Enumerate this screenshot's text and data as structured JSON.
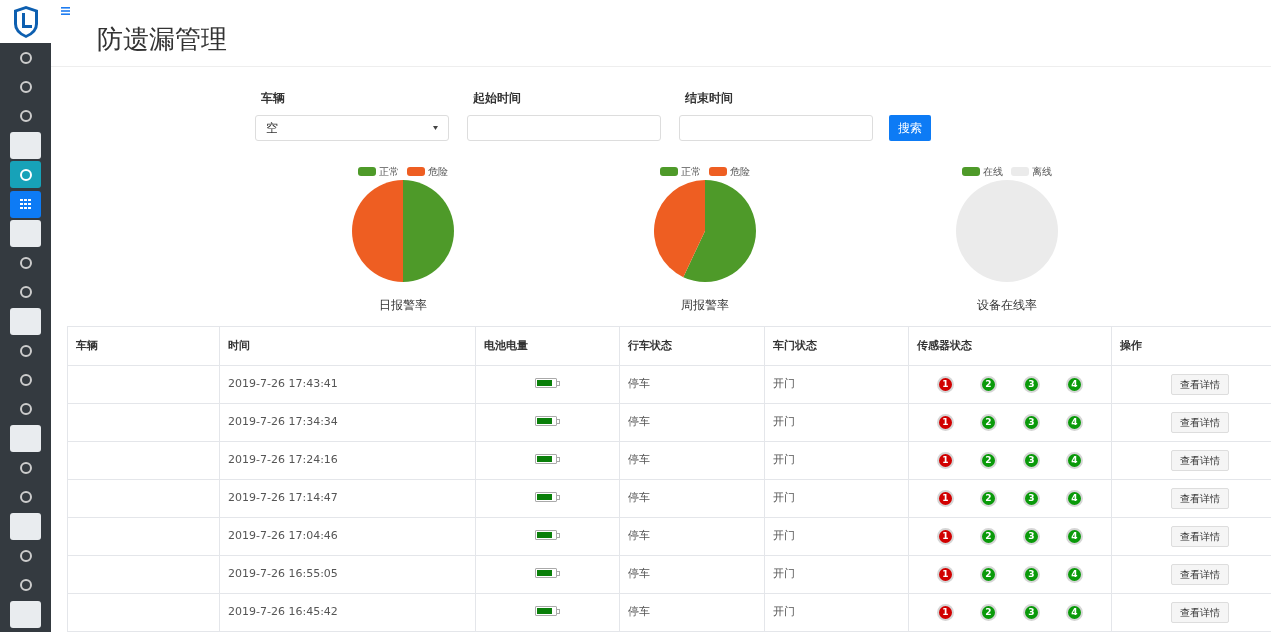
{
  "sidebar": {
    "items": [
      {
        "kind": "circle",
        "selected": false
      },
      {
        "kind": "circle",
        "selected": false
      },
      {
        "kind": "circle",
        "selected": false
      },
      {
        "kind": "blank",
        "selected": false
      },
      {
        "kind": "circle",
        "selected": false,
        "highlighted": true
      },
      {
        "kind": "grid",
        "selected": true
      },
      {
        "kind": "blank",
        "selected": false
      },
      {
        "kind": "circle",
        "selected": false
      },
      {
        "kind": "circle",
        "selected": false
      },
      {
        "kind": "blank",
        "selected": false
      },
      {
        "kind": "circle",
        "selected": false
      },
      {
        "kind": "circle",
        "selected": false
      },
      {
        "kind": "circle",
        "selected": false
      },
      {
        "kind": "blank",
        "selected": false
      },
      {
        "kind": "circle",
        "selected": false
      },
      {
        "kind": "circle",
        "selected": false
      },
      {
        "kind": "blank",
        "selected": false
      },
      {
        "kind": "circle",
        "selected": false
      },
      {
        "kind": "circle",
        "selected": false
      },
      {
        "kind": "blank",
        "selected": false
      }
    ]
  },
  "page_title": "防遗漏管理",
  "filters": [
    {
      "kind": "select",
      "label": "车辆",
      "value": "空"
    },
    {
      "kind": "input",
      "label": "起始时间"
    },
    {
      "kind": "input",
      "label": "结束时间"
    }
  ],
  "search_button": "搜索",
  "charts": [
    {
      "title": "日报警率",
      "legend": [
        {
          "label": "正常",
          "color": "#4e9a29"
        },
        {
          "label": "危险",
          "color": "#ee5e22"
        }
      ]
    },
    {
      "title": "周报警率",
      "legend": [
        {
          "label": "正常",
          "color": "#4e9a29"
        },
        {
          "label": "危险",
          "color": "#ee5e22"
        }
      ]
    },
    {
      "title": "设备在线率",
      "legend": [
        {
          "label": "在线",
          "color": "#4e9a29"
        },
        {
          "label": "离线",
          "color": "#ebebeb"
        }
      ]
    }
  ],
  "table": {
    "columns": [
      "车辆",
      "时间",
      "电池电量",
      "行车状态",
      "车门状态",
      "传感器状态",
      "操作"
    ],
    "rows": [
      {
        "time": "2019-7-26 17:43:41",
        "battery": {
          "level": 0.85
        },
        "drive": "停车",
        "door": "开门",
        "sensors": [
          {
            "label": "1",
            "ok": false
          },
          {
            "label": "2",
            "ok": true
          },
          {
            "label": "3",
            "ok": true
          },
          {
            "label": "4",
            "ok": true
          }
        ],
        "action": "查看详情"
      },
      {
        "time": "2019-7-26 17:34:34",
        "battery": {
          "level": 0.85
        },
        "drive": "停车",
        "door": "开门",
        "sensors": [
          {
            "label": "1",
            "ok": false
          },
          {
            "label": "2",
            "ok": true
          },
          {
            "label": "3",
            "ok": true
          },
          {
            "label": "4",
            "ok": true
          }
        ],
        "action": "查看详情"
      },
      {
        "time": "2019-7-26 17:24:16",
        "battery": {
          "level": 0.85
        },
        "drive": "停车",
        "door": "开门",
        "sensors": [
          {
            "label": "1",
            "ok": false
          },
          {
            "label": "2",
            "ok": true
          },
          {
            "label": "3",
            "ok": true
          },
          {
            "label": "4",
            "ok": true
          }
        ],
        "action": "查看详情"
      },
      {
        "time": "2019-7-26 17:14:47",
        "battery": {
          "level": 0.85
        },
        "drive": "停车",
        "door": "开门",
        "sensors": [
          {
            "label": "1",
            "ok": false
          },
          {
            "label": "2",
            "ok": true
          },
          {
            "label": "3",
            "ok": true
          },
          {
            "label": "4",
            "ok": true
          }
        ],
        "action": "查看详情"
      },
      {
        "time": "2019-7-26 17:04:46",
        "battery": {
          "level": 0.85
        },
        "drive": "停车",
        "door": "开门",
        "sensors": [
          {
            "label": "1",
            "ok": false
          },
          {
            "label": "2",
            "ok": true
          },
          {
            "label": "3",
            "ok": true
          },
          {
            "label": "4",
            "ok": true
          }
        ],
        "action": "查看详情"
      },
      {
        "time": "2019-7-26 16:55:05",
        "battery": {
          "level": 0.85
        },
        "drive": "停车",
        "door": "开门",
        "sensors": [
          {
            "label": "1",
            "ok": false
          },
          {
            "label": "2",
            "ok": true
          },
          {
            "label": "3",
            "ok": true
          },
          {
            "label": "4",
            "ok": true
          }
        ],
        "action": "查看详情"
      },
      {
        "time": "2019-7-26 16:45:42",
        "battery": {
          "level": 0.85
        },
        "drive": "停车",
        "door": "开门",
        "sensors": [
          {
            "label": "1",
            "ok": false
          },
          {
            "label": "2",
            "ok": true
          },
          {
            "label": "3",
            "ok": true
          },
          {
            "label": "4",
            "ok": true
          }
        ],
        "action": "查看详情"
      }
    ]
  }
}
